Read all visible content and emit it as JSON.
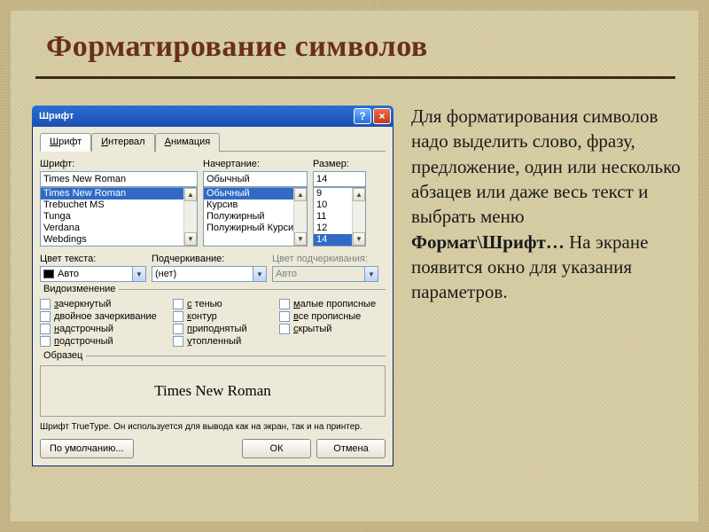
{
  "slide": {
    "title": "Форматирование символов",
    "desc_prefix": "Для форматирования символов надо выделить слово, фразу, предложение, один или несколько абзацев или даже весь текст и выбрать меню ",
    "desc_bold": "Формат\\Шрифт…",
    "desc_suffix": " На экране появится окно для указания параметров."
  },
  "dialog": {
    "caption": "Шрифт",
    "help": "?",
    "close": "×",
    "tabs": [
      {
        "label": "Шрифт",
        "u": "Ш",
        "rest": "рифт",
        "active": true
      },
      {
        "label": "Интервал",
        "u": "И",
        "rest": "нтервал",
        "active": false
      },
      {
        "label": "Анимация",
        "u": "А",
        "rest": "нимация",
        "active": false
      }
    ],
    "font": {
      "label": "Шрифт:",
      "value": "Times New Roman",
      "items": [
        "Times New Roman",
        "Trebuchet MS",
        "Tunga",
        "Verdana",
        "Webdings"
      ],
      "selected": "Times New Roman"
    },
    "style": {
      "label": "Начертание:",
      "value": "Обычный",
      "items": [
        "Обычный",
        "Курсив",
        "Полужирный",
        "Полужирный Курсив"
      ],
      "selected": "Обычный"
    },
    "size": {
      "label": "Размер:",
      "value": "14",
      "items": [
        "9",
        "10",
        "11",
        "12",
        "14"
      ],
      "selected": "14"
    },
    "color": {
      "label": "Цвет текста:",
      "value": "Авто"
    },
    "underline": {
      "label": "Подчеркивание:",
      "value": "(нет)"
    },
    "ucolor": {
      "label": "Цвет подчеркивания:",
      "value": "Авто"
    },
    "effects_title": "Видоизменение",
    "effects": {
      "c1": [
        {
          "u": "з",
          "rest": "ачеркнутый"
        },
        {
          "u": "д",
          "rest": "войное зачеркивание"
        },
        {
          "u": "н",
          "rest": "адстрочный"
        },
        {
          "u": "п",
          "rest": "одстрочный"
        }
      ],
      "c2": [
        {
          "u": "с",
          "rest": " тенью"
        },
        {
          "u": "к",
          "rest": "онтур"
        },
        {
          "u": "п",
          "rest": "риподнятый"
        },
        {
          "u": "у",
          "rest": "топленный"
        }
      ],
      "c3": [
        {
          "u": "м",
          "rest": "алые прописные"
        },
        {
          "u": "в",
          "rest": "се прописные"
        },
        {
          "u": "с",
          "rest": "крытый"
        }
      ]
    },
    "sample_title": "Образец",
    "sample_text": "Times New Roman",
    "hint": "Шрифт TrueType. Он используется для вывода как на экран, так и на принтер.",
    "buttons": {
      "default": "По умолчанию...",
      "ok": "ОК",
      "cancel": "Отмена"
    }
  }
}
